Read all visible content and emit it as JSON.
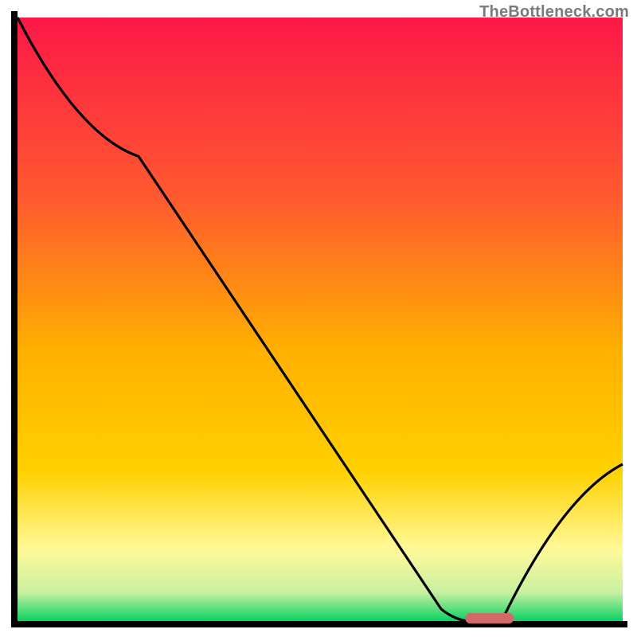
{
  "attribution": "TheBottleneck.com",
  "colors": {
    "gradient_top": "#fc1847",
    "gradient_mid1": "#ff7a2f",
    "gradient_mid2": "#ffd100",
    "gradient_mid3": "#fff99a",
    "gradient_bottom": "#00d060",
    "axis": "#000000",
    "curve": "#000000",
    "marker": "#d36a6a"
  },
  "chart_data": {
    "type": "line",
    "title": "",
    "xlabel": "",
    "ylabel": "",
    "xlim": [
      0,
      100
    ],
    "ylim": [
      0,
      100
    ],
    "grid": false,
    "series": [
      {
        "name": "bottleneck-curve",
        "x": [
          0,
          20,
          70,
          75,
          80,
          100
        ],
        "values": [
          100,
          77,
          2,
          0,
          0,
          26
        ]
      }
    ],
    "annotations": [
      {
        "name": "optimal-range",
        "type": "marker",
        "x_from": 74,
        "x_to": 82,
        "y": 0
      }
    ],
    "legend": false
  }
}
